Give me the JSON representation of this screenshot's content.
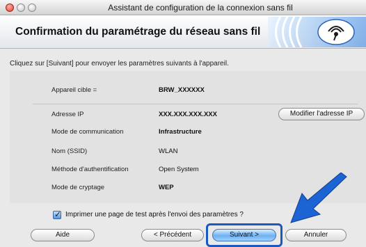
{
  "window": {
    "title": "Assistant de configuration de la connexion sans fil"
  },
  "header": {
    "title": "Confirmation du paramétrage du réseau sans fil",
    "logo_icon": "wifi-logo-icon"
  },
  "instruction": "Cliquez sur [Suivant] pour envoyer les paramètres suivants à l'appareil.",
  "device": {
    "label": "Appareil cible =",
    "value": "BRW_XXXXXX"
  },
  "params": [
    {
      "label": "Adresse IP",
      "value": "XXX.XXX.XXX.XXX"
    },
    {
      "label": "Mode de communication",
      "value": "Infrastructure"
    },
    {
      "label": "Nom (SSID)",
      "value": "WLAN"
    },
    {
      "label": "Méthode d'authentification",
      "value": "Open System"
    },
    {
      "label": "Mode de cryptage",
      "value": "WEP"
    }
  ],
  "buttons": {
    "modify_ip": "Modifier l'adresse IP",
    "help": "Aide",
    "previous": "< Précédent",
    "next": "Suivant >",
    "cancel": "Annuler"
  },
  "print_test": {
    "label": "Imprimer une page de test après l'envoi des paramètres ?",
    "checked": true
  },
  "colors": {
    "highlight": "#1a58c2",
    "arrow": "#1c63d3",
    "default_button": "#6fb1f2"
  }
}
